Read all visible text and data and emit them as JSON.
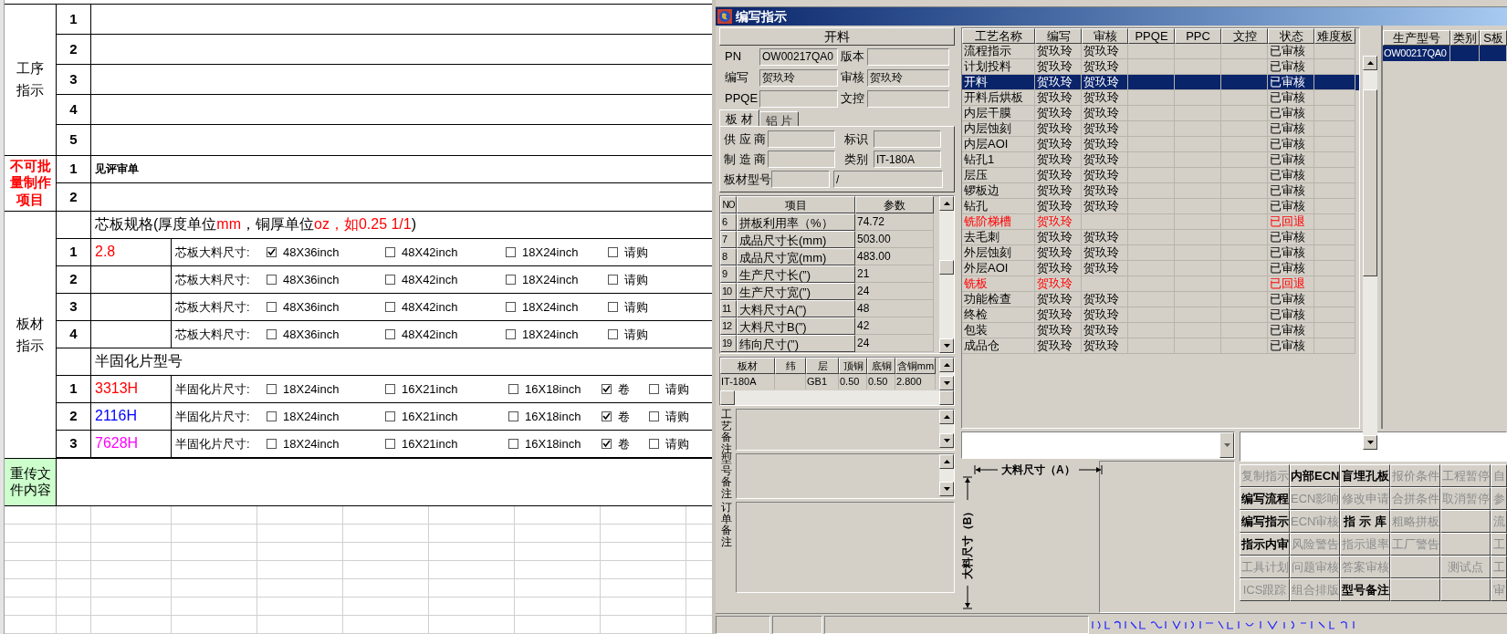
{
  "sheet": {
    "process": {
      "label": "工序指示",
      "rows": [
        {
          "no": "1"
        },
        {
          "no": "2"
        },
        {
          "no": "3"
        },
        {
          "no": "4"
        },
        {
          "no": "5"
        }
      ]
    },
    "non_batch": {
      "label": "不可批量制作项目",
      "rows": [
        {
          "no": "1",
          "text": "见评审单"
        },
        {
          "no": "2"
        }
      ]
    },
    "material": {
      "label": "板材指示",
      "core_heading": [
        {
          "text": "芯板规格(厚度单位",
          "color": "#000000"
        },
        {
          "text": "mm",
          "color": "#ff0000"
        },
        {
          "text": "，铜厚单位",
          "color": "#000000"
        },
        {
          "text": "oz，如0.25 1/1",
          "color": "#ff0000"
        },
        {
          "text": ")",
          "color": "#000000"
        }
      ],
      "core_rows": [
        {
          "no": "1",
          "value": "2.8",
          "color": "#ff0000",
          "size_label": "芯板大料尺寸:",
          "options": [
            {
              "label": "48X36inch",
              "checked": true
            },
            {
              "label": "48X42inch",
              "checked": false
            },
            {
              "label": "18X24inch",
              "checked": false
            },
            {
              "label": "请购",
              "checked": false
            }
          ]
        },
        {
          "no": "2",
          "size_label": "芯板大料尺寸:",
          "options": [
            {
              "label": "48X36inch",
              "checked": false
            },
            {
              "label": "48X42inch",
              "checked": false
            },
            {
              "label": "18X24inch",
              "checked": false
            },
            {
              "label": "请购",
              "checked": false
            }
          ]
        },
        {
          "no": "3",
          "size_label": "芯板大料尺寸:",
          "options": [
            {
              "label": "48X36inch",
              "checked": false
            },
            {
              "label": "48X42inch",
              "checked": false
            },
            {
              "label": "18X24inch",
              "checked": false
            },
            {
              "label": "请购",
              "checked": false
            }
          ]
        },
        {
          "no": "4",
          "size_label": "芯板大料尺寸:",
          "options": [
            {
              "label": "48X36inch",
              "checked": false
            },
            {
              "label": "48X42inch",
              "checked": false
            },
            {
              "label": "18X24inch",
              "checked": false
            },
            {
              "label": "请购",
              "checked": false
            }
          ]
        }
      ],
      "prepreg_heading": "半固化片型号",
      "prepreg_rows": [
        {
          "no": "1",
          "value": "3313H",
          "color": "#ff0000",
          "size_label": "半固化片尺寸:",
          "options": [
            {
              "label": "18X24inch",
              "checked": false
            },
            {
              "label": "16X21inch",
              "checked": false
            },
            {
              "label": "16X18inch",
              "checked": false
            },
            {
              "label": "卷",
              "checked": true
            },
            {
              "label": "请购",
              "checked": false
            }
          ]
        },
        {
          "no": "2",
          "value": "2116H",
          "color": "#0000ff",
          "size_label": "半固化片尺寸:",
          "options": [
            {
              "label": "18X24inch",
              "checked": false
            },
            {
              "label": "16X21inch",
              "checked": false
            },
            {
              "label": "16X18inch",
              "checked": false
            },
            {
              "label": "卷",
              "checked": true
            },
            {
              "label": "请购",
              "checked": false
            }
          ]
        },
        {
          "no": "3",
          "value": "7628H",
          "color": "#ff00ff",
          "size_label": "半固化片尺寸:",
          "options": [
            {
              "label": "18X24inch",
              "checked": false
            },
            {
              "label": "16X21inch",
              "checked": false
            },
            {
              "label": "16X18inch",
              "checked": false
            },
            {
              "label": "卷",
              "checked": true
            },
            {
              "label": "请购",
              "checked": false
            }
          ]
        }
      ]
    },
    "resend": {
      "label": "重传文件内容"
    }
  },
  "dialog": {
    "title": "编写指示",
    "step_title": "开料",
    "fields": [
      {
        "label": "PN",
        "value": "OW00217QA0"
      },
      {
        "label": "版本"
      },
      {
        "label": "编写",
        "value": "贺玖玲"
      },
      {
        "label": "审核",
        "value": "贺玖玲"
      },
      {
        "label": "PPQE"
      },
      {
        "label": "文控"
      }
    ],
    "tabs": [
      {
        "label": "板 材",
        "selected": true
      },
      {
        "label": "铝 片",
        "selected": false
      }
    ],
    "material_fields": [
      {
        "label": "供 应 商"
      },
      {
        "label": "标识"
      },
      {
        "label": "制 造 商"
      },
      {
        "label": "类别",
        "value": "IT-180A"
      }
    ],
    "model_field": {
      "label": "板材型号",
      "extra_value": "/"
    },
    "params": {
      "columns": [
        "NO",
        "项目",
        "参数"
      ],
      "rows": [
        [
          "6",
          "拼板利用率（%）",
          "74.72"
        ],
        [
          "7",
          "成品尺寸长(mm)",
          "503.00"
        ],
        [
          "8",
          "成品尺寸宽(mm)",
          "483.00"
        ],
        [
          "9",
          "生产尺寸长(”)",
          "21"
        ],
        [
          "10",
          "生产尺寸宽(”)",
          "24"
        ],
        [
          "11",
          "大料尺寸A(”)",
          "48"
        ],
        [
          "12",
          "大料尺寸B(”)",
          "42"
        ],
        [
          "19",
          "纬向尺寸(”)",
          "24"
        ]
      ]
    },
    "layers": {
      "columns": [
        "板材",
        "纬",
        "层",
        "顶铜",
        "底铜",
        "含铜mm"
      ],
      "rows": [
        {
          "material": "IT-180A",
          "layer": "GB1",
          "top_copper": "0.50",
          "bottom_copper": "0.50",
          "copper": "2.800"
        }
      ]
    },
    "remarks": [
      {
        "label": "工艺备注",
        "kind": "scrolled"
      },
      {
        "label": "型号备注",
        "kind": "scrolled"
      },
      {
        "label": "订单备注",
        "kind": "plain"
      }
    ],
    "process_table": {
      "columns": [
        "工艺名称",
        "编写",
        "审核",
        "PPQE",
        "PPC",
        "文控",
        "状态",
        "难度板"
      ],
      "rows": [
        {
          "name": "流程指示",
          "writer": "贺玖玲",
          "reviewer": "贺玖玲",
          "status": "已审核",
          "selected": false,
          "returned": false
        },
        {
          "name": "计划投料",
          "writer": "贺玖玲",
          "reviewer": "贺玖玲",
          "status": "已审核",
          "selected": false,
          "returned": false
        },
        {
          "name": "开料",
          "writer": "贺玖玲",
          "reviewer": "贺玖玲",
          "status": "已审核",
          "selected": true,
          "returned": false
        },
        {
          "name": "开料后烘板",
          "writer": "贺玖玲",
          "reviewer": "贺玖玲",
          "status": "已审核",
          "selected": false,
          "returned": false
        },
        {
          "name": "内层干膜",
          "writer": "贺玖玲",
          "reviewer": "贺玖玲",
          "status": "已审核",
          "selected": false,
          "returned": false
        },
        {
          "name": "内层蚀刻",
          "writer": "贺玖玲",
          "reviewer": "贺玖玲",
          "status": "已审核",
          "selected": false,
          "returned": false
        },
        {
          "name": "内层AOI",
          "writer": "贺玖玲",
          "reviewer": "贺玖玲",
          "status": "已审核",
          "selected": false,
          "returned": false
        },
        {
          "name": "钻孔1",
          "writer": "贺玖玲",
          "reviewer": "贺玖玲",
          "status": "已审核",
          "selected": false,
          "returned": false
        },
        {
          "name": "层压",
          "writer": "贺玖玲",
          "reviewer": "贺玖玲",
          "status": "已审核",
          "selected": false,
          "returned": false
        },
        {
          "name": "锣板边",
          "writer": "贺玖玲",
          "reviewer": "贺玖玲",
          "status": "已审核",
          "selected": false,
          "returned": false
        },
        {
          "name": "钻孔",
          "writer": "贺玖玲",
          "reviewer": "贺玖玲",
          "status": "已审核",
          "selected": false,
          "returned": false
        },
        {
          "name": "铣阶梯槽",
          "writer": "贺玖玲",
          "status": "已回退",
          "selected": false,
          "returned": true
        },
        {
          "name": "去毛刺",
          "writer": "贺玖玲",
          "reviewer": "贺玖玲",
          "status": "已审核",
          "selected": false,
          "returned": false
        },
        {
          "name": "外层蚀刻",
          "writer": "贺玖玲",
          "reviewer": "贺玖玲",
          "status": "已审核",
          "selected": false,
          "returned": false
        },
        {
          "name": "外层AOI",
          "writer": "贺玖玲",
          "reviewer": "贺玖玲",
          "status": "已审核",
          "selected": false,
          "returned": false
        },
        {
          "name": "铣板",
          "writer": "贺玖玲",
          "status": "已回退",
          "selected": false,
          "returned": true
        },
        {
          "name": "功能检查",
          "writer": "贺玖玲",
          "reviewer": "贺玖玲",
          "status": "已审核",
          "selected": false,
          "returned": false
        },
        {
          "name": "终检",
          "writer": "贺玖玲",
          "reviewer": "贺玖玲",
          "status": "已审核",
          "selected": false,
          "returned": false
        },
        {
          "name": "包装",
          "writer": "贺玖玲",
          "reviewer": "贺玖玲",
          "status": "已审核",
          "selected": false,
          "returned": false
        },
        {
          "name": "成品仓",
          "writer": "贺玖玲",
          "reviewer": "贺玖玲",
          "status": "已审核",
          "selected": false,
          "returned": false
        }
      ]
    },
    "models": {
      "columns": [
        "生产型号",
        "类别",
        "S板"
      ],
      "rows": [
        {
          "model": "OW00217QA0",
          "selected": true
        }
      ]
    },
    "diagram": {
      "a_label": "大料尺寸（A）",
      "b_label": "大料尺寸（B）"
    },
    "buttons": [
      [
        {
          "kind": "button",
          "label": "复制指示",
          "disabled": true
        },
        {
          "kind": "button",
          "label": "内部ECN",
          "disabled": false
        },
        {
          "kind": "button",
          "label": "盲埋孔板",
          "disabled": false
        },
        {
          "kind": "button",
          "label": "报价条件",
          "disabled": true
        },
        {
          "kind": "button",
          "label": "工程暂停",
          "disabled": true
        },
        {
          "kind": "button",
          "label": "自",
          "disabled": true
        }
      ],
      [
        {
          "kind": "button",
          "label": "编写流程",
          "disabled": false
        },
        {
          "kind": "button",
          "label": "ECN影响",
          "disabled": true
        },
        {
          "kind": "button",
          "label": "修改申请",
          "disabled": true
        },
        {
          "kind": "button",
          "label": "合拼条件",
          "disabled": true
        },
        {
          "kind": "button",
          "label": "取消暂停",
          "disabled": true
        },
        {
          "kind": "button",
          "label": "参",
          "disabled": true
        }
      ],
      [
        {
          "kind": "button",
          "label": "编写指示",
          "disabled": false
        },
        {
          "kind": "button",
          "label": "ECN审核",
          "disabled": true
        },
        {
          "kind": "button",
          "label": "指 示 库",
          "disabled": false
        },
        {
          "kind": "button",
          "label": "粗略拼板",
          "disabled": true
        },
        {
          "kind": "blank"
        },
        {
          "kind": "button",
          "label": "流",
          "disabled": true
        }
      ],
      [
        {
          "kind": "button",
          "label": "指示内审",
          "disabled": false
        },
        {
          "kind": "button",
          "label": "风险警告",
          "disabled": true
        },
        {
          "kind": "button",
          "label": "指示退率",
          "disabled": true
        },
        {
          "kind": "button",
          "label": "工厂警告",
          "disabled": true
        },
        {
          "kind": "blank"
        },
        {
          "kind": "button",
          "label": "工",
          "disabled": true
        }
      ],
      [
        {
          "kind": "button",
          "label": "工具计划",
          "disabled": true
        },
        {
          "kind": "button",
          "label": "问题审核",
          "disabled": true
        },
        {
          "kind": "button",
          "label": "答案审核",
          "disabled": true
        },
        {
          "kind": "blank"
        },
        {
          "kind": "button",
          "label": "测试点",
          "disabled": true
        },
        {
          "kind": "button",
          "label": "工",
          "disabled": true
        }
      ],
      [
        {
          "kind": "button",
          "label": "ICS跟踪",
          "disabled": true
        },
        {
          "kind": "button",
          "label": "组合排版",
          "disabled": true
        },
        {
          "kind": "button",
          "label": "型号备注",
          "disabled": false
        },
        {
          "kind": "blank"
        },
        {
          "kind": "blank"
        },
        {
          "kind": "button",
          "label": "审",
          "disabled": true
        }
      ]
    ]
  }
}
